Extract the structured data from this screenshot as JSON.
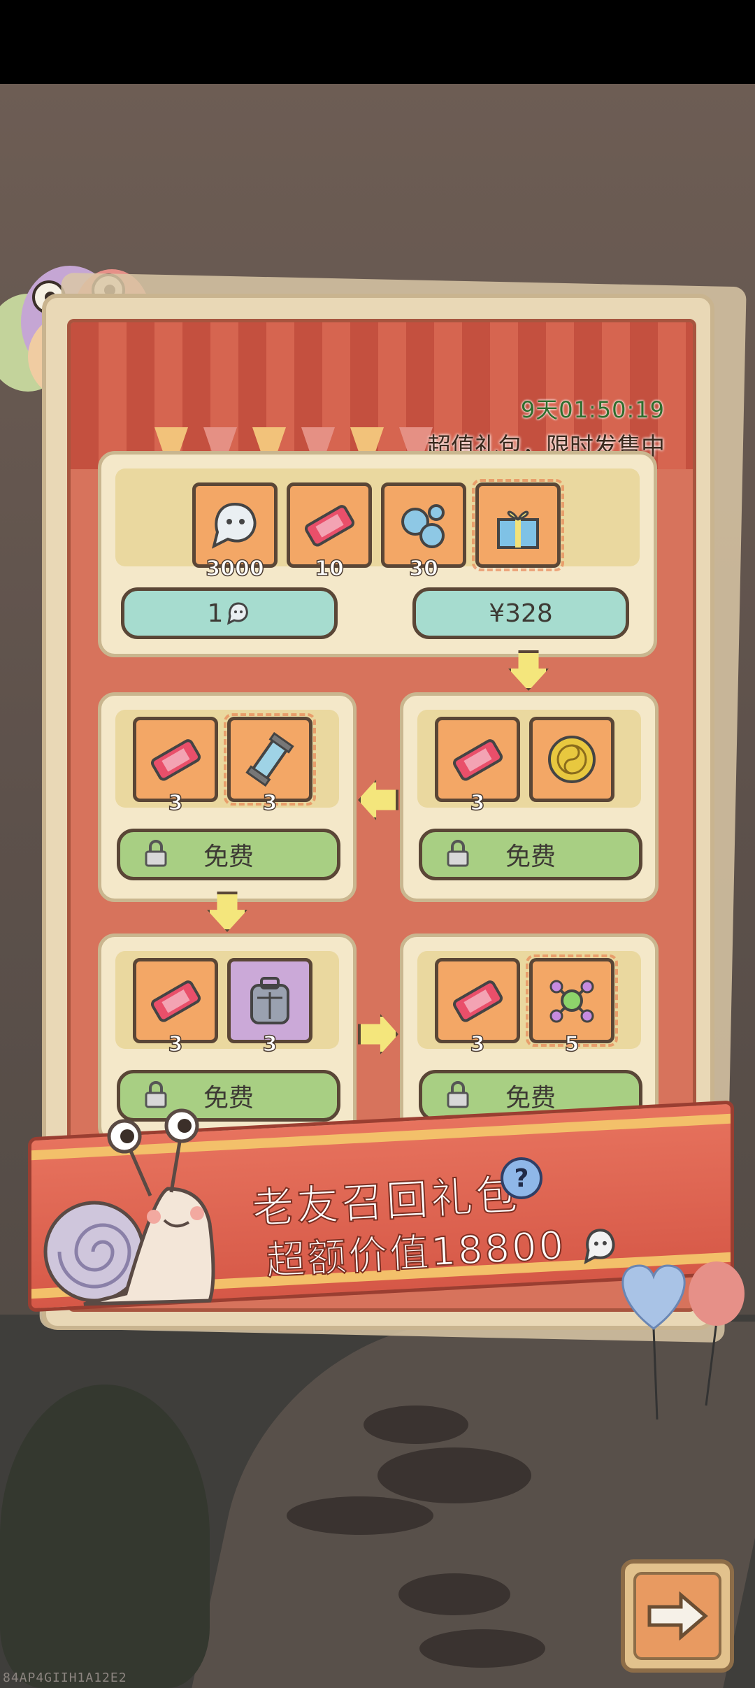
{
  "timer": "9天01:50:19",
  "subtitle": "超值礼包，限时发售中",
  "top_bundle": {
    "items": [
      {
        "icon": "ghost-currency-icon",
        "qty": "3000"
      },
      {
        "icon": "ticket-icon",
        "qty": "10"
      },
      {
        "icon": "blue-orbs-icon",
        "qty": "30"
      },
      {
        "icon": "gift-box-icon",
        "qty": ""
      }
    ],
    "left_button_label": "1",
    "right_button_label": "¥328"
  },
  "reward_panels": [
    {
      "items": [
        {
          "icon": "ticket-icon",
          "qty": "3"
        },
        {
          "icon": "crystal-tube-icon",
          "qty": "3"
        }
      ],
      "button_label": "免费"
    },
    {
      "items": [
        {
          "icon": "ticket-icon",
          "qty": "3"
        },
        {
          "icon": "yin-yang-coin-icon",
          "qty": ""
        }
      ],
      "button_label": "免费"
    },
    {
      "items": [
        {
          "icon": "ticket-icon",
          "qty": "3"
        },
        {
          "icon": "backpack-icon",
          "qty": "3"
        }
      ],
      "button_label": "免费"
    },
    {
      "items": [
        {
          "icon": "ticket-icon",
          "qty": "3"
        },
        {
          "icon": "molecule-icon",
          "qty": "5"
        }
      ],
      "button_label": "免费"
    }
  ],
  "banner": {
    "title": "老友召回礼包",
    "subtitle": "超额价值18800",
    "help_label": "?"
  },
  "watermark": "84AP4GIIH1A12E2",
  "colors": {
    "tile_orange": "#f3a766",
    "button_teal": "#a6dccf",
    "button_green": "#a8cf83",
    "banner_red": "#d65847"
  }
}
